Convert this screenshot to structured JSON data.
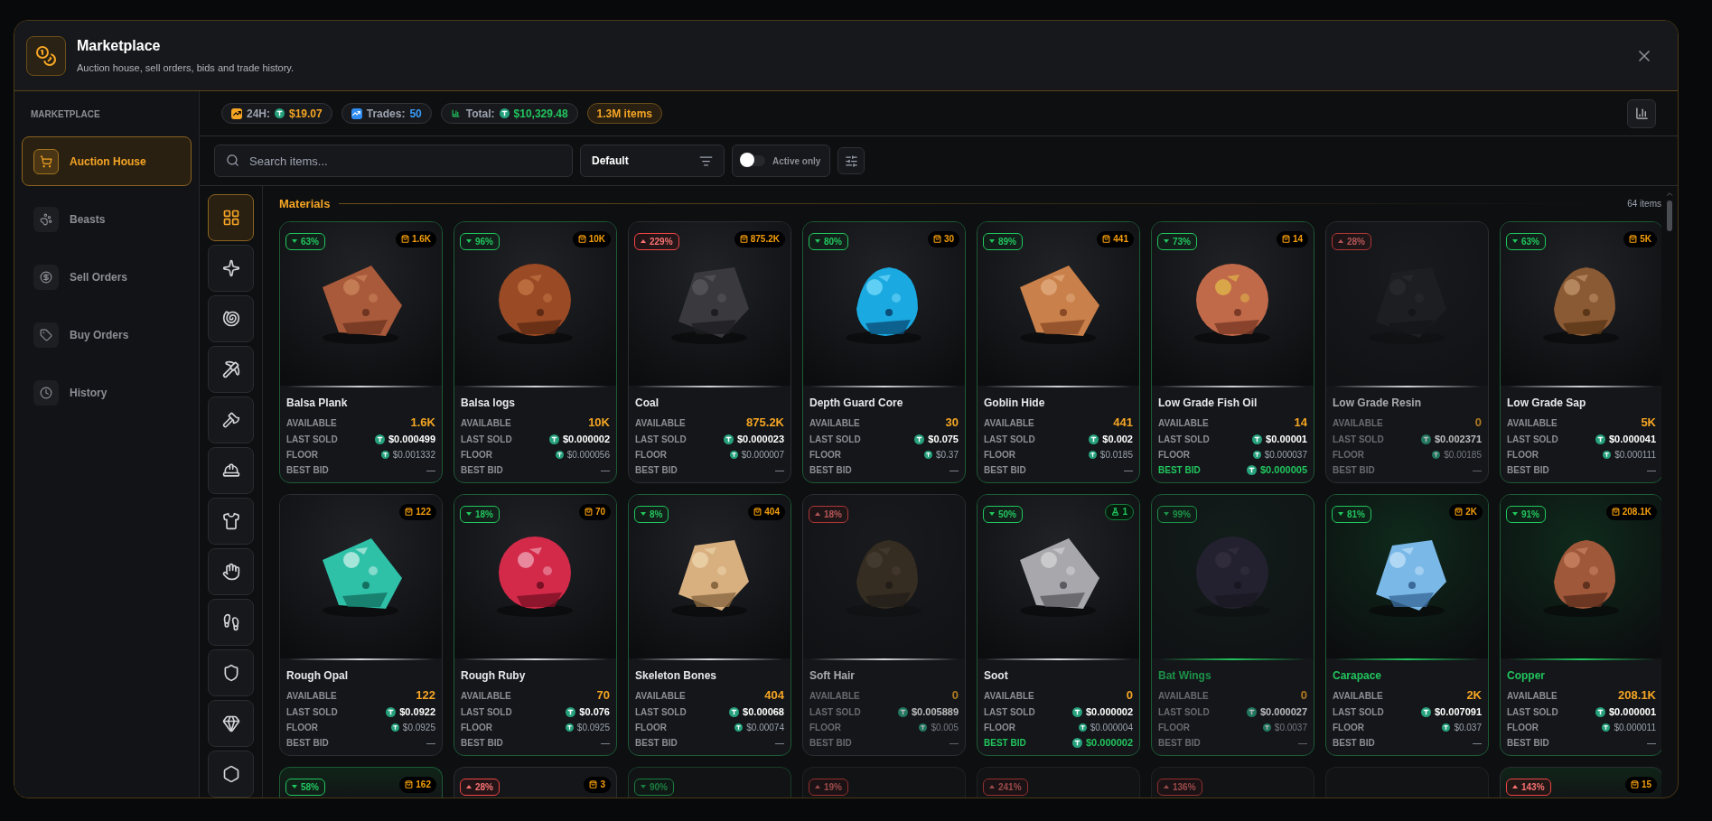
{
  "header": {
    "title": "Marketplace",
    "subtitle": "Auction house, sell orders, bids and trade history."
  },
  "sidebar": {
    "heading": "MARKETPLACE",
    "items": [
      {
        "label": "Auction House",
        "selected": true
      },
      {
        "label": "Beasts",
        "selected": false
      },
      {
        "label": "Sell Orders",
        "selected": false
      },
      {
        "label": "Buy Orders",
        "selected": false
      },
      {
        "label": "History",
        "selected": false
      }
    ]
  },
  "stats": [
    {
      "kind": "day",
      "label": "24H:",
      "value": "$19.07"
    },
    {
      "kind": "trades",
      "label": "Trades:",
      "value": "50"
    },
    {
      "kind": "total",
      "label": "Total:",
      "value": "$10,329.48"
    },
    {
      "kind": "items",
      "value": "1.3M items"
    }
  ],
  "toolbar": {
    "search": {
      "placeholder": "Search items..."
    },
    "sort": {
      "value": "Default"
    },
    "active_only": {
      "label": "Active only",
      "on": false
    }
  },
  "categories": [
    {
      "selected": true
    },
    {
      "selected": false
    },
    {
      "selected": false
    },
    {
      "selected": false
    },
    {
      "selected": false
    },
    {
      "selected": false
    },
    {
      "selected": false
    },
    {
      "selected": false
    },
    {
      "selected": false
    },
    {
      "selected": false
    },
    {
      "selected": false
    },
    {
      "selected": false
    }
  ],
  "section": {
    "title": "Materials",
    "count": "64 items"
  },
  "cards": [
    {
      "name": "Balsa Plank",
      "faded": false,
      "featured": false,
      "change": {
        "text": "63%",
        "up": false
      },
      "stock": {
        "text": "1.6K",
        "kind": "bag"
      },
      "stats": [
        {
          "kind": "available",
          "label": "AVAILABLE",
          "value": "1.6K"
        },
        {
          "kind": "last_sold",
          "label": "LAST SOLD",
          "value": "$0.000499"
        },
        {
          "kind": "floor",
          "label": "FLOOR",
          "value": "$0.001332"
        },
        {
          "kind": "bid",
          "label": "BEST BID",
          "value": "—",
          "active": false
        }
      ]
    },
    {
      "name": "Balsa logs",
      "faded": false,
      "featured": false,
      "change": {
        "text": "96%",
        "up": false
      },
      "stock": {
        "text": "10K",
        "kind": "bag"
      },
      "stats": [
        {
          "kind": "available",
          "label": "AVAILABLE",
          "value": "10K"
        },
        {
          "kind": "last_sold",
          "label": "LAST SOLD",
          "value": "$0.000002"
        },
        {
          "kind": "floor",
          "label": "FLOOR",
          "value": "$0.000056"
        },
        {
          "kind": "bid",
          "label": "BEST BID",
          "value": "—",
          "active": false
        }
      ]
    },
    {
      "name": "Coal",
      "faded": false,
      "featured": false,
      "change": {
        "text": "229%",
        "up": true
      },
      "stock": {
        "text": "875.2K",
        "kind": "bag"
      },
      "stats": [
        {
          "kind": "available",
          "label": "AVAILABLE",
          "value": "875.2K"
        },
        {
          "kind": "last_sold",
          "label": "LAST SOLD",
          "value": "$0.000023"
        },
        {
          "kind": "floor",
          "label": "FLOOR",
          "value": "$0.000007"
        },
        {
          "kind": "bid",
          "label": "BEST BID",
          "value": "—",
          "active": false
        }
      ]
    },
    {
      "name": "Depth Guard Core",
      "faded": false,
      "featured": false,
      "change": {
        "text": "80%",
        "up": false
      },
      "stock": {
        "text": "30",
        "kind": "bag"
      },
      "stats": [
        {
          "kind": "available",
          "label": "AVAILABLE",
          "value": "30"
        },
        {
          "kind": "last_sold",
          "label": "LAST SOLD",
          "value": "$0.075"
        },
        {
          "kind": "floor",
          "label": "FLOOR",
          "value": "$0.37"
        },
        {
          "kind": "bid",
          "label": "BEST BID",
          "value": "—",
          "active": false
        }
      ]
    },
    {
      "name": "Goblin Hide",
      "faded": false,
      "featured": false,
      "change": {
        "text": "89%",
        "up": false
      },
      "stock": {
        "text": "441",
        "kind": "bag"
      },
      "stats": [
        {
          "kind": "available",
          "label": "AVAILABLE",
          "value": "441"
        },
        {
          "kind": "last_sold",
          "label": "LAST SOLD",
          "value": "$0.002"
        },
        {
          "kind": "floor",
          "label": "FLOOR",
          "value": "$0.0185"
        },
        {
          "kind": "bid",
          "label": "BEST BID",
          "value": "—",
          "active": false
        }
      ]
    },
    {
      "name": "Low Grade Fish Oil",
      "faded": false,
      "featured": false,
      "change": {
        "text": "73%",
        "up": false
      },
      "stock": {
        "text": "14",
        "kind": "bag"
      },
      "stats": [
        {
          "kind": "available",
          "label": "AVAILABLE",
          "value": "14"
        },
        {
          "kind": "last_sold",
          "label": "LAST SOLD",
          "value": "$0.00001"
        },
        {
          "kind": "floor",
          "label": "FLOOR",
          "value": "$0.000037"
        },
        {
          "kind": "bid",
          "label": "BEST BID",
          "value": "$0.000005",
          "active": true
        }
      ]
    },
    {
      "name": "Low Grade Resin",
      "faded": true,
      "featured": false,
      "change": {
        "text": "28%",
        "up": true
      },
      "stats": [
        {
          "kind": "available",
          "label": "AVAILABLE",
          "value": "0"
        },
        {
          "kind": "last_sold",
          "label": "LAST SOLD",
          "value": "$0.002371"
        },
        {
          "kind": "floor",
          "label": "FLOOR",
          "value": "$0.00185"
        },
        {
          "kind": "bid",
          "label": "BEST BID",
          "value": "—",
          "active": false
        }
      ]
    },
    {
      "name": "Low Grade Sap",
      "faded": false,
      "featured": false,
      "change": {
        "text": "63%",
        "up": false
      },
      "stock": {
        "text": "5K",
        "kind": "bag"
      },
      "stats": [
        {
          "kind": "available",
          "label": "AVAILABLE",
          "value": "5K"
        },
        {
          "kind": "last_sold",
          "label": "LAST SOLD",
          "value": "$0.000041"
        },
        {
          "kind": "floor",
          "label": "FLOOR",
          "value": "$0.000111"
        },
        {
          "kind": "bid",
          "label": "BEST BID",
          "value": "—",
          "active": false
        }
      ]
    },
    {
      "name": "Rough Opal",
      "faded": false,
      "featured": false,
      "stock": {
        "text": "122",
        "kind": "bag"
      },
      "stats": [
        {
          "kind": "available",
          "label": "AVAILABLE",
          "value": "122"
        },
        {
          "kind": "last_sold",
          "label": "LAST SOLD",
          "value": "$0.0922"
        },
        {
          "kind": "floor",
          "label": "FLOOR",
          "value": "$0.0925"
        },
        {
          "kind": "bid",
          "label": "BEST BID",
          "value": "—",
          "active": false
        }
      ]
    },
    {
      "name": "Rough Ruby",
      "faded": false,
      "featured": false,
      "change": {
        "text": "18%",
        "up": false
      },
      "stock": {
        "text": "70",
        "kind": "bag"
      },
      "stats": [
        {
          "kind": "available",
          "label": "AVAILABLE",
          "value": "70"
        },
        {
          "kind": "last_sold",
          "label": "LAST SOLD",
          "value": "$0.076"
        },
        {
          "kind": "floor",
          "label": "FLOOR",
          "value": "$0.0925"
        },
        {
          "kind": "bid",
          "label": "BEST BID",
          "value": "—",
          "active": false
        }
      ]
    },
    {
      "name": "Skeleton Bones",
      "faded": false,
      "featured": false,
      "change": {
        "text": "8%",
        "up": false
      },
      "stock": {
        "text": "404",
        "kind": "bag"
      },
      "stats": [
        {
          "kind": "available",
          "label": "AVAILABLE",
          "value": "404"
        },
        {
          "kind": "last_sold",
          "label": "LAST SOLD",
          "value": "$0.00068"
        },
        {
          "kind": "floor",
          "label": "FLOOR",
          "value": "$0.00074"
        },
        {
          "kind": "bid",
          "label": "BEST BID",
          "value": "—",
          "active": false
        }
      ]
    },
    {
      "name": "Soft Hair",
      "faded": true,
      "featured": false,
      "change": {
        "text": "18%",
        "up": true
      },
      "stats": [
        {
          "kind": "available",
          "label": "AVAILABLE",
          "value": "0"
        },
        {
          "kind": "last_sold",
          "label": "LAST SOLD",
          "value": "$0.005889"
        },
        {
          "kind": "floor",
          "label": "FLOOR",
          "value": "$0.005"
        },
        {
          "kind": "bid",
          "label": "BEST BID",
          "value": "—",
          "active": false
        }
      ]
    },
    {
      "name": "Soot",
      "faded": false,
      "featured": false,
      "change": {
        "text": "50%",
        "up": false
      },
      "stock": {
        "text": "1",
        "kind": "vial"
      },
      "stats": [
        {
          "kind": "available",
          "label": "AVAILABLE",
          "value": "0"
        },
        {
          "kind": "last_sold",
          "label": "LAST SOLD",
          "value": "$0.000002"
        },
        {
          "kind": "floor",
          "label": "FLOOR",
          "value": "$0.000004"
        },
        {
          "kind": "bid",
          "label": "BEST BID",
          "value": "$0.000002",
          "active": true
        }
      ]
    },
    {
      "name": "Bat Wings",
      "faded": true,
      "featured": true,
      "change": {
        "text": "99%",
        "up": false
      },
      "stats": [
        {
          "kind": "available",
          "label": "AVAILABLE",
          "value": "0"
        },
        {
          "kind": "last_sold",
          "label": "LAST SOLD",
          "value": "$0.000027"
        },
        {
          "kind": "floor",
          "label": "FLOOR",
          "value": "$0.0037"
        },
        {
          "kind": "bid",
          "label": "BEST BID",
          "value": "—",
          "active": false
        }
      ]
    },
    {
      "name": "Carapace",
      "faded": false,
      "featured": true,
      "change": {
        "text": "81%",
        "up": false
      },
      "stock": {
        "text": "2K",
        "kind": "bag"
      },
      "stats": [
        {
          "kind": "available",
          "label": "AVAILABLE",
          "value": "2K"
        },
        {
          "kind": "last_sold",
          "label": "LAST SOLD",
          "value": "$0.007091"
        },
        {
          "kind": "floor",
          "label": "FLOOR",
          "value": "$0.037"
        },
        {
          "kind": "bid",
          "label": "BEST BID",
          "value": "—",
          "active": false
        }
      ]
    },
    {
      "name": "Copper",
      "faded": false,
      "featured": true,
      "change": {
        "text": "91%",
        "up": false
      },
      "stock": {
        "text": "208.1K",
        "kind": "bag"
      },
      "stats": [
        {
          "kind": "available",
          "label": "AVAILABLE",
          "value": "208.1K"
        },
        {
          "kind": "last_sold",
          "label": "LAST SOLD",
          "value": "$0.000001"
        },
        {
          "kind": "floor",
          "label": "FLOOR",
          "value": "$0.000011"
        },
        {
          "kind": "bid",
          "label": "BEST BID",
          "value": "—",
          "active": false
        }
      ]
    },
    {
      "faded": false,
      "featured": true,
      "change": {
        "text": "58%",
        "up": false
      },
      "stock": {
        "text": "162",
        "kind": "bag"
      }
    },
    {
      "faded": false,
      "featured": false,
      "change": {
        "text": "28%",
        "up": true
      },
      "stock": {
        "text": "3",
        "kind": "bag"
      }
    },
    {
      "faded": true,
      "featured": false,
      "change": {
        "text": "90%",
        "up": false
      }
    },
    {
      "faded": true,
      "featured": false,
      "change": {
        "text": "19%",
        "up": true
      }
    },
    {
      "faded": true,
      "featured": false,
      "change": {
        "text": "241%",
        "up": true
      }
    },
    {
      "faded": true,
      "featured": false,
      "change": {
        "text": "136%",
        "up": true
      }
    },
    {
      "faded": true,
      "featured": false
    },
    {
      "faded": false,
      "featured": true,
      "change": {
        "text": "143%",
        "up": true
      },
      "stock": {
        "text": "15",
        "kind": "bag"
      }
    }
  ]
}
